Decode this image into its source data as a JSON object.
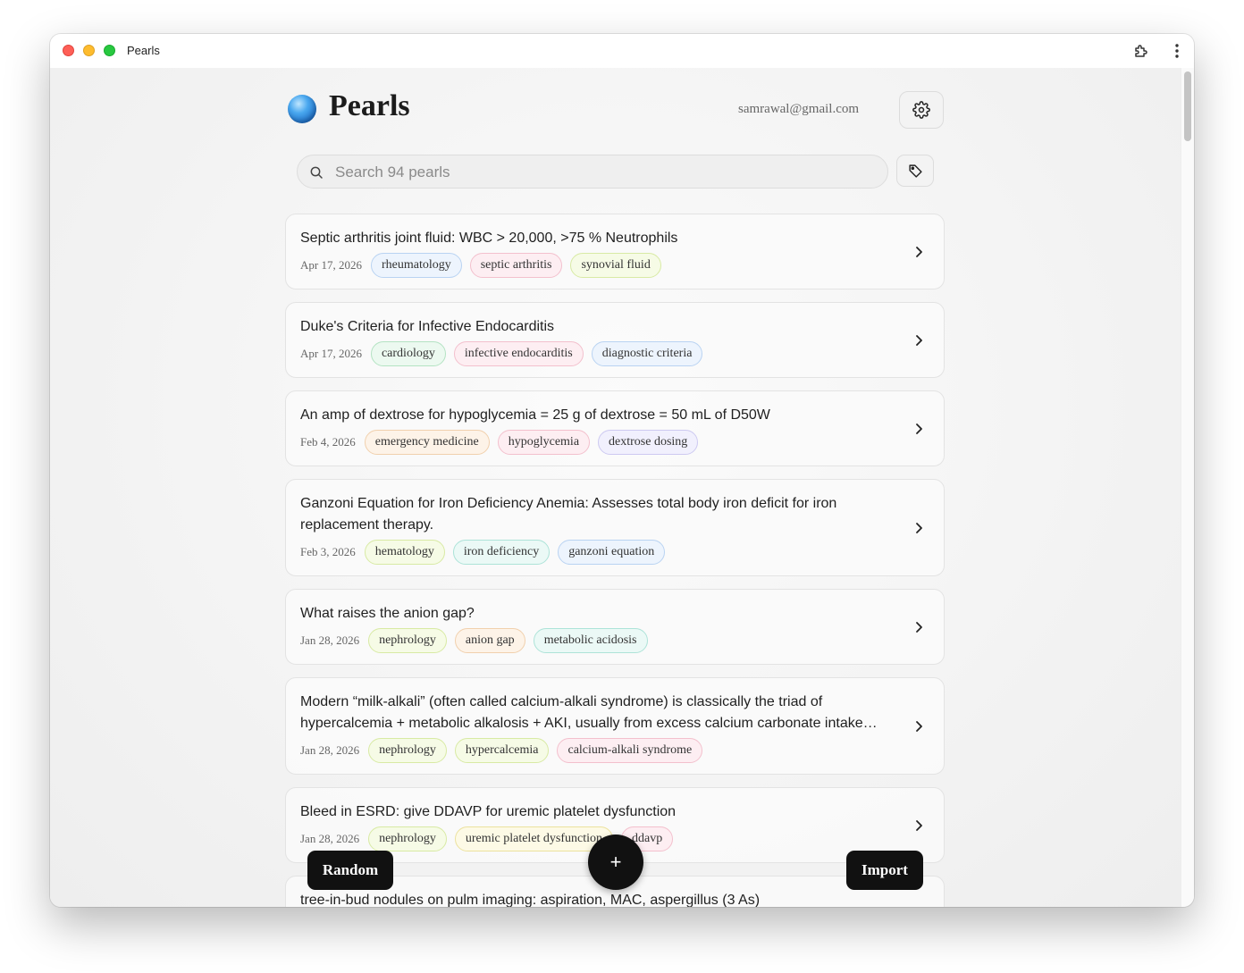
{
  "window": {
    "title": "Pearls"
  },
  "header": {
    "app_title": "Pearls",
    "email": "samrawal@gmail.com"
  },
  "search": {
    "placeholder": "Search 94 pearls",
    "value": ""
  },
  "pearls": [
    {
      "title": "Septic arthritis joint fluid: WBC > 20,000, >75 % Neutrophils",
      "date": "Apr 17, 2026",
      "tags": [
        {
          "label": "rheumatology",
          "color": "blue"
        },
        {
          "label": "septic arthritis",
          "color": "pink"
        },
        {
          "label": "synovial fluid",
          "color": "lime"
        }
      ]
    },
    {
      "title": "Duke's Criteria for Infective Endocarditis",
      "date": "Apr 17, 2026",
      "tags": [
        {
          "label": "cardiology",
          "color": "green"
        },
        {
          "label": "infective endocarditis",
          "color": "pink"
        },
        {
          "label": "diagnostic criteria",
          "color": "blue"
        }
      ]
    },
    {
      "title": "An amp of dextrose for hypoglycemia = 25 g of dextrose = 50 mL of D50W",
      "date": "Feb 4, 2026",
      "tags": [
        {
          "label": "emergency medicine",
          "color": "orange"
        },
        {
          "label": "hypoglycemia",
          "color": "pink"
        },
        {
          "label": "dextrose dosing",
          "color": "lavender"
        }
      ]
    },
    {
      "title": "Ganzoni Equation for Iron Deficiency Anemia: Assesses total body iron deficit for iron replacement therapy.",
      "date": "Feb 3, 2026",
      "tags": [
        {
          "label": "hematology",
          "color": "lime"
        },
        {
          "label": "iron deficiency",
          "color": "teal"
        },
        {
          "label": "ganzoni equation",
          "color": "blue"
        }
      ]
    },
    {
      "title": "What raises the anion gap?",
      "date": "Jan 28, 2026",
      "tags": [
        {
          "label": "nephrology",
          "color": "lime"
        },
        {
          "label": "anion gap",
          "color": "orange"
        },
        {
          "label": "metabolic acidosis",
          "color": "teal"
        }
      ]
    },
    {
      "title": "Modern “milk-alkali” (often called calcium-alkali syndrome) is classically the triad of hypercalcemia + metabolic alkalosis + AKI, usually from excess calcium carbonate intake…",
      "date": "Jan 28, 2026",
      "tags": [
        {
          "label": "nephrology",
          "color": "lime"
        },
        {
          "label": "hypercalcemia",
          "color": "lime"
        },
        {
          "label": "calcium-alkali syndrome",
          "color": "pink"
        }
      ]
    },
    {
      "title": "Bleed in ESRD: give DDAVP for uremic platelet dysfunction",
      "date": "Jan 28, 2026",
      "tags": [
        {
          "label": "nephrology",
          "color": "lime"
        },
        {
          "label": "uremic platelet dysfunction",
          "color": "yellow"
        },
        {
          "label": "ddavp",
          "color": "pink"
        }
      ]
    },
    {
      "title": "tree-in-bud nodules on pulm imaging: aspiration, MAC, aspergillus (3 As)",
      "date": "",
      "tags": []
    }
  ],
  "tag_colors": {
    "blue": {
      "bg": "#edf4fd",
      "border": "#b9d3f2"
    },
    "pink": {
      "bg": "#fdeef2",
      "border": "#f3c0cd"
    },
    "lime": {
      "bg": "#f6fbe6",
      "border": "#d8eaa4"
    },
    "green": {
      "bg": "#ecf9f0",
      "border": "#b4e3c3"
    },
    "orange": {
      "bg": "#fdf3e8",
      "border": "#f1d0ad"
    },
    "lavender": {
      "bg": "#f1f0fd",
      "border": "#cdc9f1"
    },
    "teal": {
      "bg": "#ebf9f6",
      "border": "#ade3d8"
    },
    "yellow": {
      "bg": "#fdfae6",
      "border": "#ece29e"
    }
  },
  "actions": {
    "random_label": "Random",
    "add_label": "+",
    "import_label": "Import"
  }
}
